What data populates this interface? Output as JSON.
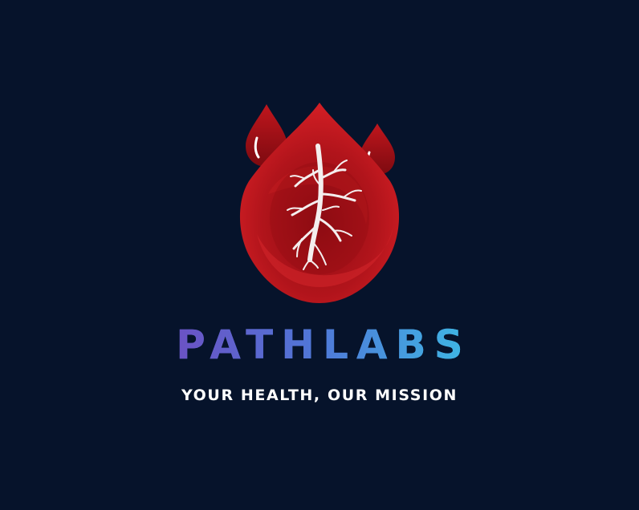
{
  "logo": {
    "icon": "blood-drop-icon",
    "brand_name": "PATHLABS",
    "tagline": "YOUR HEALTH, OUR MISSION"
  },
  "colors": {
    "background": "#06132b",
    "drop_red": "#b3121a",
    "drop_dark_red": "#7d0a10",
    "brand_gradient_start": "#6b52c4",
    "brand_gradient_end": "#3eb8e4",
    "tagline": "#ffffff"
  }
}
